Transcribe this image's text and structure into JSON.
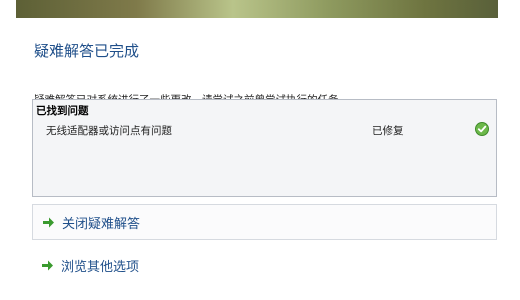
{
  "window": {
    "title": "疑难解答已完成",
    "description": "疑难解答已对系统进行了一些更改。请尝试之前曾尝试执行的任务。"
  },
  "results": {
    "heading": "已找到问题",
    "items": [
      {
        "problem": "无线适配器或访问点有问题",
        "status": "已修复",
        "status_icon": "check-icon",
        "status_color": "#5fae3a"
      }
    ]
  },
  "options": [
    {
      "label": "关闭疑难解答",
      "icon": "green-arrow-icon"
    },
    {
      "label": "浏览其他选项",
      "icon": "green-arrow-icon"
    }
  ],
  "colors": {
    "title_blue": "#1f4f8a",
    "arrow_green": "#3a9a2e"
  }
}
